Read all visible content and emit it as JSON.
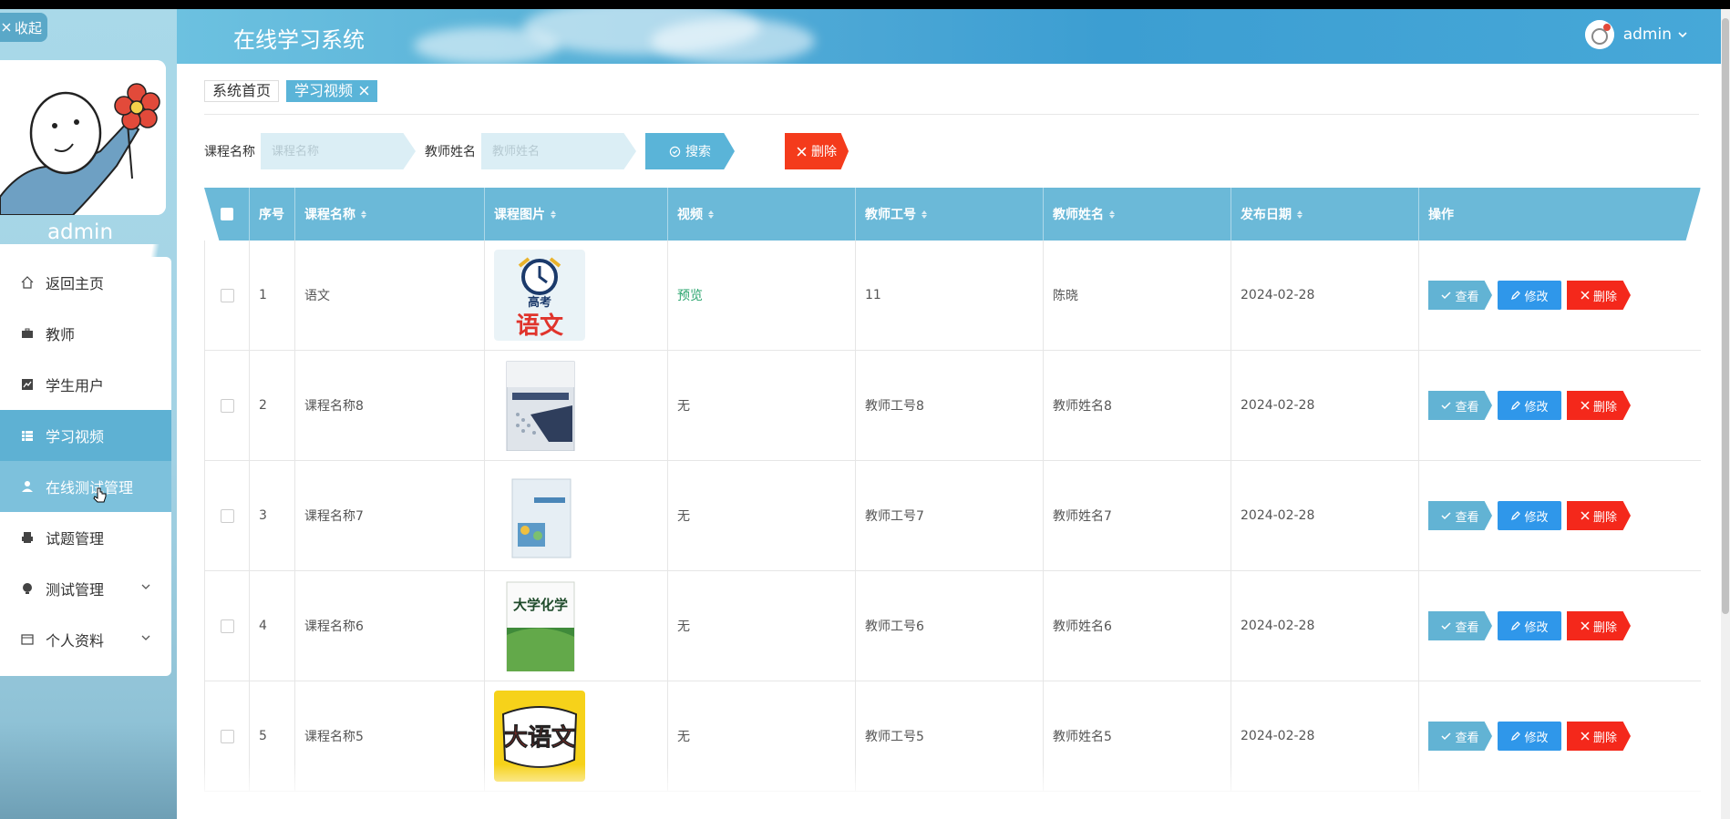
{
  "app": {
    "title": "在线学习系统",
    "collapse_label": "收起",
    "user": "admin"
  },
  "sidebar": {
    "user_name": "admin",
    "items": [
      {
        "label": "返回主页",
        "icon": "home-icon"
      },
      {
        "label": "教师",
        "icon": "briefcase-icon"
      },
      {
        "label": "学生用户",
        "icon": "chart-icon"
      },
      {
        "label": "学习视频",
        "icon": "grid-icon"
      },
      {
        "label": "在线测试管理",
        "icon": "user-icon"
      },
      {
        "label": "试题管理",
        "icon": "printer-icon"
      },
      {
        "label": "测试管理",
        "icon": "lightbulb-icon"
      },
      {
        "label": "个人资料",
        "icon": "card-icon"
      }
    ]
  },
  "breadcrumb": {
    "home": "系统首页",
    "current": "学习视频"
  },
  "search": {
    "course_label": "课程名称",
    "course_placeholder": "课程名称",
    "course_value": "",
    "teacher_label": "教师姓名",
    "teacher_placeholder": "教师姓名",
    "teacher_value": "",
    "search_button": "搜索",
    "delete_button": "删除"
  },
  "table": {
    "headers": [
      "序号",
      "课程名称",
      "课程图片",
      "视频",
      "教师工号",
      "教师姓名",
      "发布日期",
      "操作"
    ],
    "actions": {
      "view": "查看",
      "edit": "修改",
      "delete": "删除"
    },
    "rows": [
      {
        "index": "1",
        "course": "语文",
        "video": "预览",
        "teacher_id": "11",
        "teacher_name": "陈晓",
        "date": "2024-02-28"
      },
      {
        "index": "2",
        "course": "课程名称8",
        "video": "无",
        "teacher_id": "教师工号8",
        "teacher_name": "教师姓名8",
        "date": "2024-02-28"
      },
      {
        "index": "3",
        "course": "课程名称7",
        "video": "无",
        "teacher_id": "教师工号7",
        "teacher_name": "教师姓名7",
        "date": "2024-02-28"
      },
      {
        "index": "4",
        "course": "课程名称6",
        "video": "无",
        "teacher_id": "教师工号6",
        "teacher_name": "教师姓名6",
        "date": "2024-02-28"
      },
      {
        "index": "5",
        "course": "课程名称5",
        "video": "无",
        "teacher_id": "教师工号5",
        "teacher_name": "教师姓名5",
        "date": "2024-02-28"
      }
    ],
    "thumb_texts": {
      "gaokao_top": "高考",
      "gaokao_big": "语文",
      "chem": "大学化学",
      "dayuwen": "大语文"
    }
  },
  "colors": {
    "accent": "#5ab4d8",
    "danger": "#f43b1c",
    "edit": "#2f97ea",
    "preview": "#2aa56e"
  }
}
